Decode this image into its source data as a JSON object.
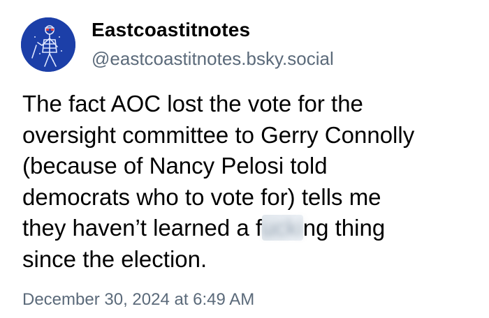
{
  "author": {
    "display_name": "Eastcoastitnotes",
    "handle": "@eastcoastitnotes.bsky.social",
    "avatar_icon": "profile-avatar-icon"
  },
  "post": {
    "text_before_blur": "The fact AOC lost the vote for the\noversight committee to Gerry Connolly\n(because of Nancy Pelosi told\ndemocrats who to vote for) tells me\nthey haven’t learned a f",
    "blurred_fragment": "ucki",
    "text_after_blur": "ng thing\nsince the election.",
    "timestamp": "December 30, 2024 at 6:49 AM"
  },
  "colors": {
    "text": "#000000",
    "muted": "#5b6a7a",
    "avatar_bg": "#1c3fa8",
    "background": "#ffffff"
  }
}
